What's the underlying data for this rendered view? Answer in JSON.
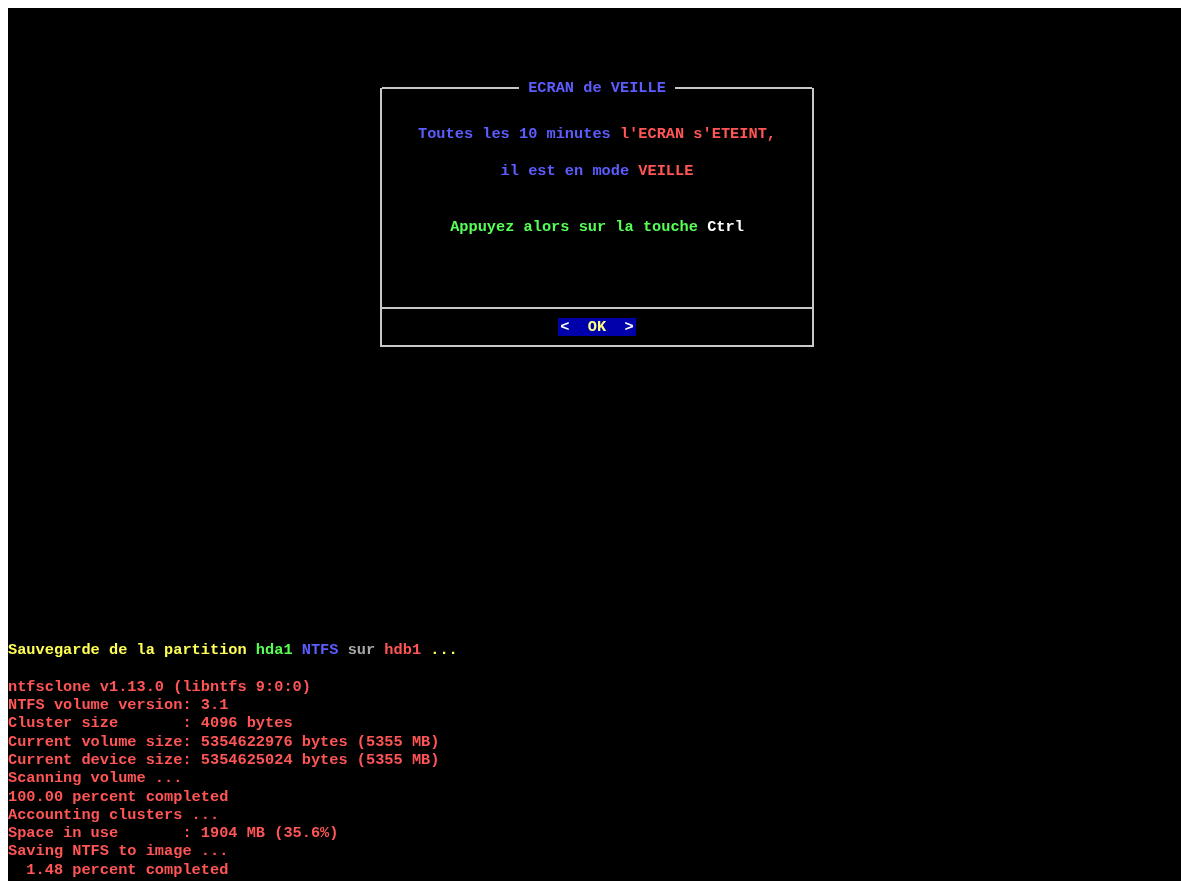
{
  "dialog": {
    "title": "ECRAN de VEILLE",
    "lines": [
      {
        "segments": [
          {
            "text": "Toutes les 10 minutes",
            "color": "#5c5cff"
          },
          {
            "text": "l'ECRAN s'ETEINT,",
            "color": "#ff5555"
          }
        ]
      },
      {
        "segments": [
          {
            "text": "il est en mode",
            "color": "#5c5cff"
          },
          {
            "text": "VEILLE",
            "color": "#ff5555"
          }
        ]
      },
      {
        "segments": [
          {
            "text": "Appuyez alors sur la touche",
            "color": "#55ff55"
          },
          {
            "text": "Ctrl",
            "color": "#ffffff"
          }
        ]
      }
    ],
    "button": {
      "left": "<",
      "label": "OK",
      "right": ">"
    }
  },
  "log": {
    "header": {
      "segments": [
        {
          "text": "Sauvegarde de la partition",
          "color": "#ffff55"
        },
        {
          "text": "hda1",
          "color": "#55ff55"
        },
        {
          "text": "NTFS",
          "color": "#5c5cff"
        },
        {
          "text": "sur",
          "color": "#aaaaaa"
        },
        {
          "text": "hdb1",
          "color": "#ff5555"
        },
        {
          "text": "...",
          "color": "#ffff55"
        }
      ]
    },
    "lines": [
      "ntfsclone v1.13.0 (libntfs 9:0:0)",
      "NTFS volume version: 3.1",
      "Cluster size       : 4096 bytes",
      "Current volume size: 5354622976 bytes (5355 MB)",
      "Current device size: 5354625024 bytes (5355 MB)",
      "Scanning volume ...",
      "100.00 percent completed",
      "Accounting clusters ...",
      "Space in use       : 1904 MB (35.6%)",
      "Saving NTFS to image ...",
      "  1.48 percent completed"
    ]
  }
}
